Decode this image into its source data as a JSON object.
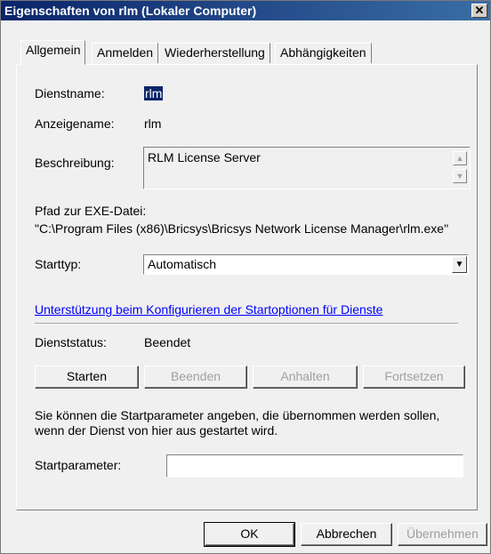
{
  "window": {
    "title": "Eigenschaften von rlm (Lokaler Computer)",
    "close_glyph": "✕"
  },
  "tabs": [
    {
      "label": "Allgemein",
      "active": true
    },
    {
      "label": "Anmelden",
      "active": false
    },
    {
      "label": "Wiederherstellung",
      "active": false
    },
    {
      "label": "Abhängigkeiten",
      "active": false
    }
  ],
  "general": {
    "service_name_label": "Dienstname:",
    "service_name_value": "rlm",
    "display_name_label": "Anzeigename:",
    "display_name_value": "rlm",
    "description_label": "Beschreibung:",
    "description_value": "RLM License Server",
    "exe_path_label": "Pfad zur EXE-Datei:",
    "exe_path_value": "\"C:\\Program Files (x86)\\Bricsys\\Bricsys Network License Manager\\rlm.exe\"",
    "startup_type_label": "Starttyp:",
    "startup_type_value": "Automatisch",
    "help_link": "Unterstützung beim Konfigurieren der Startoptionen für Dienste",
    "status_label": "Dienststatus:",
    "status_value": "Beendet",
    "start_params_hint": "Sie können die Startparameter angeben, die übernommen werden sollen, wenn der Dienst von hier aus gestartet wird.",
    "start_params_label": "Startparameter:",
    "start_params_value": ""
  },
  "service_buttons": {
    "start": "Starten",
    "stop": "Beenden",
    "pause": "Anhalten",
    "resume": "Fortsetzen"
  },
  "dialog_buttons": {
    "ok": "OK",
    "cancel": "Abbrechen",
    "apply": "Übernehmen"
  }
}
